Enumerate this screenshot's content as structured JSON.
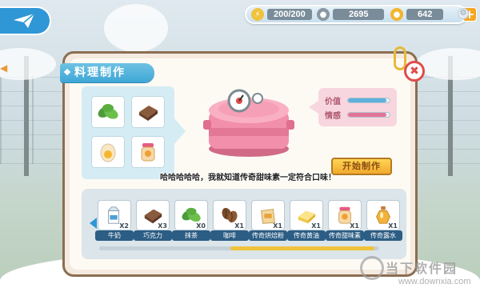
{
  "resources": {
    "stamina": "200/200",
    "silver": "2695",
    "gold": "642"
  },
  "panel": {
    "title": "料理制作",
    "stats": [
      {
        "label": "价值",
        "value": 0.92,
        "color": "#5fb0dd"
      },
      {
        "label": "情感",
        "value": 0.92,
        "color": "#e4739a"
      }
    ],
    "start_button": "开始制作",
    "dialog": "哈哈哈哈哈，我就知道传奇甜味素一定符合口味！"
  },
  "slots": [
    {
      "icon": "matcha-leaves-icon"
    },
    {
      "icon": "chocolate-icon"
    },
    {
      "icon": "egg-icon"
    },
    {
      "icon": "honey-jar-icon"
    }
  ],
  "inventory": [
    {
      "label": "牛奶",
      "count": "X2",
      "icon": "milk-carton-icon"
    },
    {
      "label": "巧克力",
      "count": "X3",
      "icon": "chocolate-icon"
    },
    {
      "label": "抹茶",
      "count": "X0",
      "icon": "matcha-leaves-icon"
    },
    {
      "label": "咖啡",
      "count": "X1",
      "icon": "coffee-bean-icon"
    },
    {
      "label": "传奇烘焙粉",
      "count": "X1",
      "icon": "baking-powder-icon"
    },
    {
      "label": "传奇黄油",
      "count": "X1",
      "icon": "butter-icon"
    },
    {
      "label": "传奇甜味素",
      "count": "X1",
      "icon": "honey-jar-icon"
    },
    {
      "label": "传奇露水",
      "count": "X1",
      "icon": "dew-bottle-icon"
    }
  ],
  "watermark": {
    "text": "当下软件园",
    "url": "www.downxia.com"
  }
}
